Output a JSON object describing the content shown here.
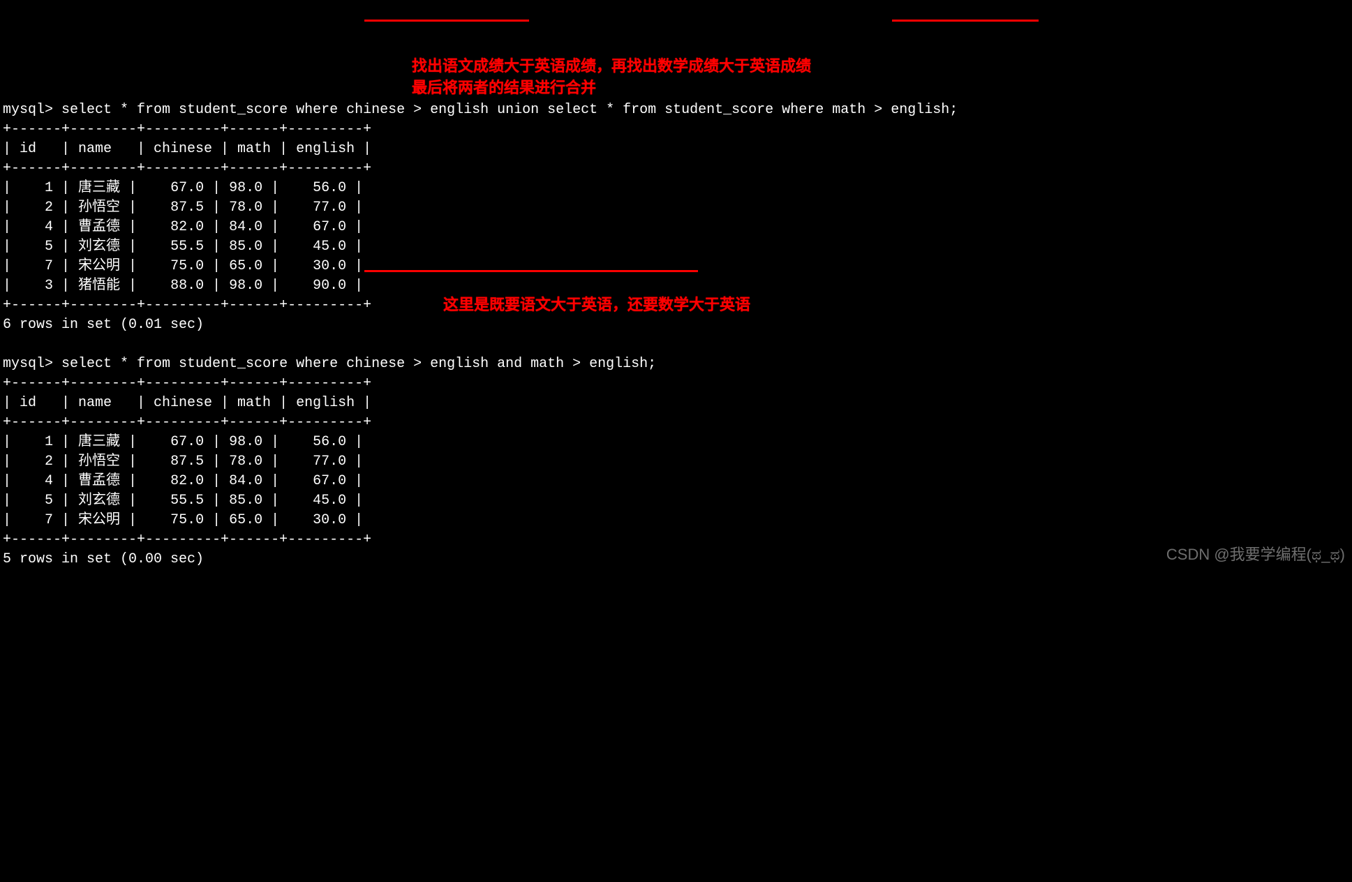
{
  "query1": {
    "prompt": "mysql> ",
    "sql": "select * from student_score where chinese > english union select * from student_score where math > english;",
    "columns": [
      "id",
      "name",
      "chinese",
      "math",
      "english"
    ],
    "rows": [
      {
        "id": "1",
        "name": "唐三藏",
        "chinese": "67.0",
        "math": "98.0",
        "english": "56.0"
      },
      {
        "id": "2",
        "name": "孙悟空",
        "chinese": "87.5",
        "math": "78.0",
        "english": "77.0"
      },
      {
        "id": "4",
        "name": "曹孟德",
        "chinese": "82.0",
        "math": "84.0",
        "english": "67.0"
      },
      {
        "id": "5",
        "name": "刘玄德",
        "chinese": "55.5",
        "math": "85.0",
        "english": "45.0"
      },
      {
        "id": "7",
        "name": "宋公明",
        "chinese": "75.0",
        "math": "65.0",
        "english": "30.0"
      },
      {
        "id": "3",
        "name": "猪悟能",
        "chinese": "88.0",
        "math": "98.0",
        "english": "90.0"
      }
    ],
    "footer": "6 rows in set (0.01 sec)"
  },
  "query2": {
    "prompt": "mysql> ",
    "sql": "select * from student_score where chinese > english and math > english;",
    "columns": [
      "id",
      "name",
      "chinese",
      "math",
      "english"
    ],
    "rows": [
      {
        "id": "1",
        "name": "唐三藏",
        "chinese": "67.0",
        "math": "98.0",
        "english": "56.0"
      },
      {
        "id": "2",
        "name": "孙悟空",
        "chinese": "87.5",
        "math": "78.0",
        "english": "77.0"
      },
      {
        "id": "4",
        "name": "曹孟德",
        "chinese": "82.0",
        "math": "84.0",
        "english": "67.0"
      },
      {
        "id": "5",
        "name": "刘玄德",
        "chinese": "55.5",
        "math": "85.0",
        "english": "45.0"
      },
      {
        "id": "7",
        "name": "宋公明",
        "chinese": "75.0",
        "math": "65.0",
        "english": "30.0"
      }
    ],
    "footer": "5 rows in set (0.00 sec)"
  },
  "annotations": {
    "a1_line1": "找出语文成绩大于英语成绩，再找出数学成绩大于英语成绩",
    "a1_line2": "最后将两者的结果进行合并",
    "a2": "这里是既要语文大于英语，还要数学大于英语"
  },
  "watermark": "CSDN @我要学编程(ಥ_ಥ)",
  "table_border": {
    "sep": "+------+--------+---------+------+---------+",
    "header": "| id   | name   | chinese | math | english |"
  }
}
